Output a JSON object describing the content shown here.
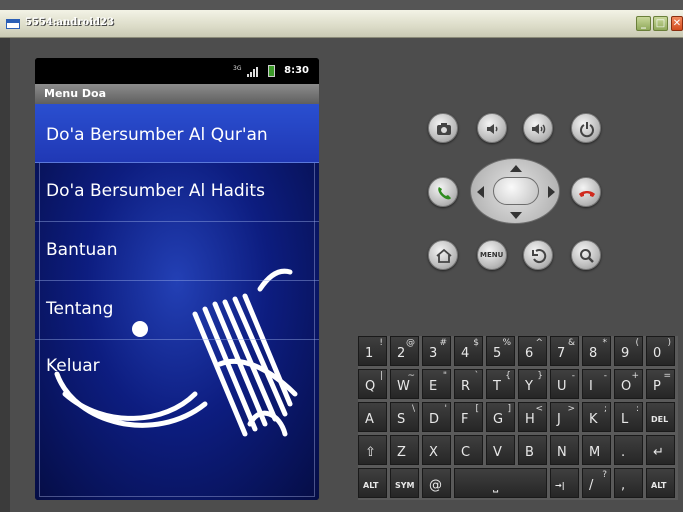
{
  "window": {
    "title": "5554:android23",
    "controls": [
      "minimize",
      "maximize",
      "close"
    ]
  },
  "statusbar": {
    "time": "8:30",
    "network_label": "3G"
  },
  "app": {
    "title": "Menu Doa",
    "menu": [
      {
        "label": "Do'a Bersumber Al Qur'an",
        "selected": true
      },
      {
        "label": "Do'a Bersumber Al Hadits",
        "selected": false
      },
      {
        "label": "Bantuan",
        "selected": false
      },
      {
        "label": "Tentang",
        "selected": false
      },
      {
        "label": "Keluar",
        "selected": false
      }
    ]
  },
  "controls": {
    "row1": [
      "camera-icon",
      "volume-down-icon",
      "volume-up-icon",
      "power-icon"
    ],
    "row2": [
      "call-icon",
      "dpad",
      "end-call-icon"
    ],
    "row3": [
      "home-icon",
      "menu-button",
      "back-icon",
      "search-icon"
    ],
    "menu_label": "MENU"
  },
  "keyboard": {
    "row1": [
      [
        "1",
        "!"
      ],
      [
        "2",
        "@"
      ],
      [
        "3",
        "#"
      ],
      [
        "4",
        "$"
      ],
      [
        "5",
        "%"
      ],
      [
        "6",
        "^"
      ],
      [
        "7",
        "&"
      ],
      [
        "8",
        "*"
      ],
      [
        "9",
        "("
      ],
      [
        "0",
        ")"
      ]
    ],
    "row2": [
      [
        "Q",
        "|"
      ],
      [
        "W",
        "~"
      ],
      [
        "E",
        "\""
      ],
      [
        "R",
        "`"
      ],
      [
        "T",
        "{"
      ],
      [
        "Y",
        "}"
      ],
      [
        "U",
        "-"
      ],
      [
        "I",
        "-"
      ],
      [
        "O",
        "+"
      ],
      [
        "P",
        "="
      ]
    ],
    "row3": [
      [
        "A",
        ""
      ],
      [
        "S",
        "\\"
      ],
      [
        "D",
        "'"
      ],
      [
        "F",
        "["
      ],
      [
        "G",
        "]"
      ],
      [
        "H",
        "<"
      ],
      [
        "J",
        ">"
      ],
      [
        "K",
        ";"
      ],
      [
        "L",
        ":"
      ],
      [
        "DEL",
        ""
      ]
    ],
    "row4": [
      [
        "⇧",
        ""
      ],
      [
        "Z",
        ""
      ],
      [
        "X",
        ""
      ],
      [
        "C",
        ""
      ],
      [
        "V",
        ""
      ],
      [
        "B",
        ""
      ],
      [
        "N",
        ""
      ],
      [
        "M",
        ""
      ],
      [
        ".",
        ""
      ],
      [
        "↵",
        ""
      ]
    ],
    "row5": [
      [
        "ALT",
        ""
      ],
      [
        "SYM",
        ""
      ],
      [
        "@",
        ""
      ],
      [
        "",
        ""
      ],
      [
        "",
        ""
      ],
      [
        "",
        ""
      ],
      [
        "→|",
        ""
      ],
      [
        "/",
        "?"
      ],
      [
        ",",
        ""
      ],
      [
        "ALT",
        ""
      ]
    ]
  },
  "colors": {
    "content_blue": "#0d1d80",
    "selection_blue": "#2a4fd0",
    "call_green": "#2e8b1e",
    "end_red": "#d02a1e"
  }
}
